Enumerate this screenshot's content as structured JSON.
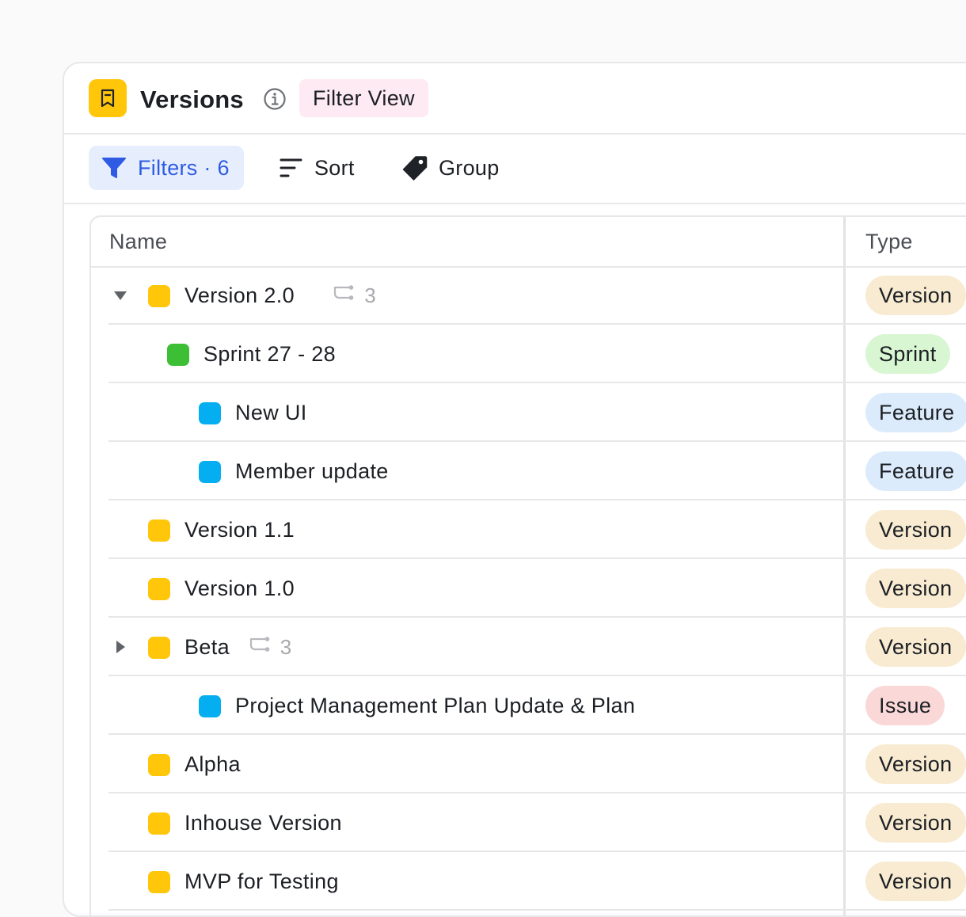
{
  "colors": {
    "version": "#ffc60a",
    "sprint": "#3cbf35",
    "feature": "#04aef0",
    "version_chip_bg": "#f8ebd1",
    "sprint_chip_bg": "#d8f6d2",
    "feature_chip_bg": "#dcebfb",
    "issue_chip_bg": "#fbd8d8",
    "filter_view_bg": "#fdeaf2",
    "filters_btn_bg": "#e6edfd",
    "accent_blue": "#2f5be4"
  },
  "header": {
    "title": "Versions",
    "app_icon": "bookmark-icon",
    "info_icon": "info-icon",
    "view_badge": "Filter View"
  },
  "toolbar": {
    "filters_label": "Filters · 6",
    "sort_label": "Sort",
    "group_label": "Group"
  },
  "table": {
    "columns": {
      "name": "Name",
      "type": "Type"
    },
    "rows": [
      {
        "name": "Version 2.0",
        "type": "Version",
        "kind": "version",
        "level": 0,
        "toggle": "expanded",
        "children": "3"
      },
      {
        "name": "Sprint 27 - 28",
        "type": "Sprint",
        "kind": "sprint",
        "level": 1
      },
      {
        "name": "New UI",
        "type": "Feature",
        "kind": "feature",
        "level": 2
      },
      {
        "name": "Member update",
        "type": "Feature",
        "kind": "feature",
        "level": 2
      },
      {
        "name": "Version 1.1",
        "type": "Version",
        "kind": "version",
        "level": 0
      },
      {
        "name": "Version 1.0",
        "type": "Version",
        "kind": "version",
        "level": 0
      },
      {
        "name": "Beta",
        "type": "Version",
        "kind": "version",
        "level": 0,
        "toggle": "collapsed",
        "children": "3"
      },
      {
        "name": "Project Management Plan Update & Plan",
        "type": "Issue",
        "kind": "issue",
        "level": 2
      },
      {
        "name": "Alpha",
        "type": "Version",
        "kind": "version",
        "level": 0
      },
      {
        "name": "Inhouse Version",
        "type": "Version",
        "kind": "version",
        "level": 0
      },
      {
        "name": "MVP for Testing",
        "type": "Version",
        "kind": "version",
        "level": 0
      }
    ]
  }
}
